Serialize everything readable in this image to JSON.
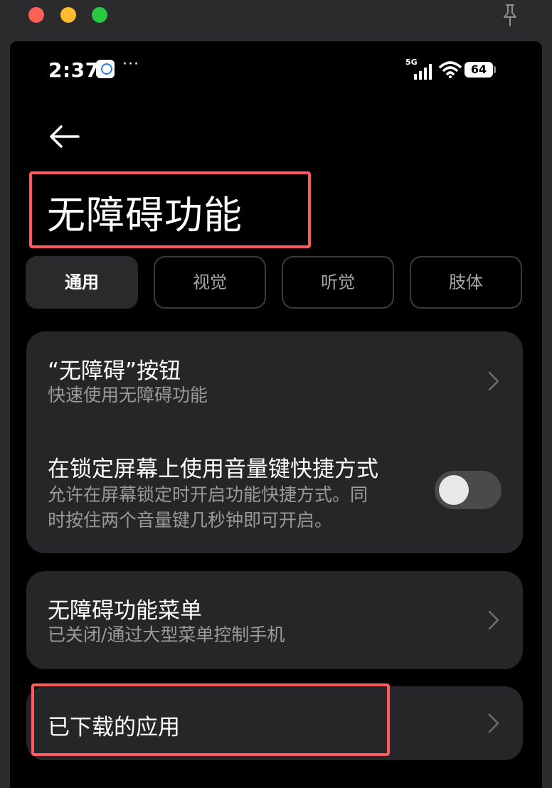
{
  "status_bar": {
    "time": "2:37",
    "more": "···",
    "network": "5G",
    "battery": "64"
  },
  "page": {
    "title": "无障碍功能"
  },
  "tabs": [
    {
      "label": "通用",
      "active": true
    },
    {
      "label": "视觉",
      "active": false
    },
    {
      "label": "听觉",
      "active": false
    },
    {
      "label": "肢体",
      "active": false
    }
  ],
  "settings": {
    "accessibility_button": {
      "title": "“无障碍”按钮",
      "subtitle": "快速使用无障碍功能"
    },
    "lock_screen_shortcut": {
      "title": "在锁定屏幕上使用音量键快捷方式",
      "subtitle_line1": "允许在屏幕锁定时开启功能快捷方式。同",
      "subtitle_line2": "时按住两个音量键几秒钟即可开启。",
      "enabled": false
    },
    "accessibility_menu": {
      "title": "无障碍功能菜单",
      "subtitle": "已关闭/通过大型菜单控制手机"
    },
    "downloaded_apps": {
      "title": "已下载的应用"
    }
  },
  "colors": {
    "highlight": "#ff5a5f",
    "card": "#262628",
    "background": "#000000"
  }
}
